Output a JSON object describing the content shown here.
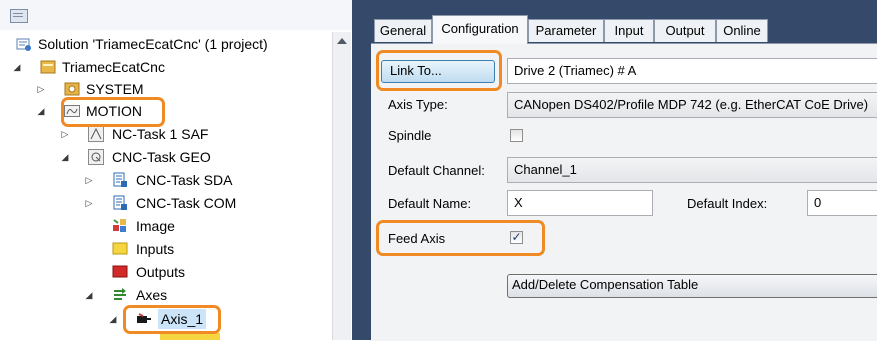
{
  "explorer": {
    "tree": [
      {
        "label": "Solution 'TriamecEcatCnc' (1 project)",
        "expander": "",
        "icon": "solution-icon"
      },
      {
        "label": "TriamecEcatCnc",
        "expander": "◢",
        "icon": "project-icon"
      },
      {
        "label": "SYSTEM",
        "expander": "▷",
        "icon": "system-icon"
      },
      {
        "label": "MOTION",
        "expander": "◢",
        "icon": "motion-icon"
      },
      {
        "label": "NC-Task 1 SAF",
        "expander": "▷",
        "icon": "nc-task-icon"
      },
      {
        "label": "CNC-Task GEO",
        "expander": "◢",
        "icon": "cnc-task-icon"
      },
      {
        "label": "CNC-Task SDA",
        "expander": "▷",
        "icon": "cnc-task-sda-icon"
      },
      {
        "label": "CNC-Task COM",
        "expander": "▷",
        "icon": "cnc-task-com-icon"
      },
      {
        "label": "Image",
        "expander": "",
        "icon": "image-icon"
      },
      {
        "label": "Inputs",
        "expander": "",
        "icon": "inputs-icon"
      },
      {
        "label": "Outputs",
        "expander": "",
        "icon": "outputs-icon"
      },
      {
        "label": "Axes",
        "expander": "◢",
        "icon": "axes-icon"
      },
      {
        "label": "Axis_1",
        "expander": "◢",
        "icon": "axis-icon"
      }
    ]
  },
  "tabs": [
    "General",
    "Configuration",
    "Parameter",
    "Input",
    "Output",
    "Online"
  ],
  "active_tab": "Configuration",
  "config": {
    "link_button": "Link To...",
    "link_value": "Drive 2 (Triamec) # A",
    "axis_type_label": "Axis Type:",
    "axis_type_value": "CANopen DS402/Profile MDP 742 (e.g. EtherCAT CoE Drive)",
    "spindle_label": "Spindle",
    "spindle_checked": false,
    "default_channel_label": "Default Channel:",
    "default_channel_value": "Channel_1",
    "default_name_label": "Default Name:",
    "default_name_value": "X",
    "default_index_label": "Default Index:",
    "default_index_value": "0",
    "feed_axis_label": "Feed Axis",
    "feed_axis_checked": true,
    "compensation_button": "Add/Delete Compensation Table"
  },
  "colors": {
    "highlight": "#f08a24",
    "panel_frame": "#35496a"
  }
}
